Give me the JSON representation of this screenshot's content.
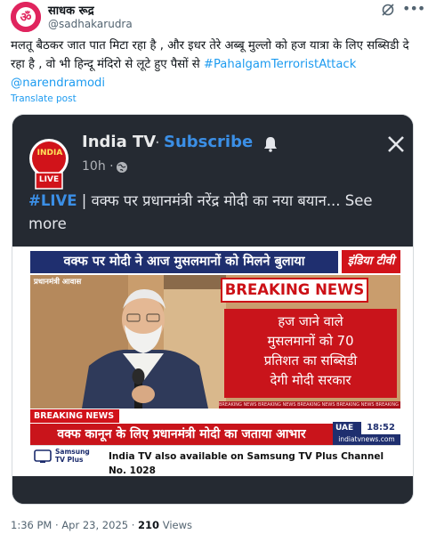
{
  "user": {
    "display_name": "साधक रूद्र",
    "handle": "@sadhakarudra",
    "avatar_color": "#e0245e"
  },
  "post": {
    "text_plain": "मलतू बैठकर जात पात मिटा रहा है , और इधर तेरे अब्बू मुल्लो को हज यात्रा के लिए सब्सिडी दे रहा है , वो भी हिन्दू मंदिरो से लूटे हुए पैसों से ",
    "hashtag": "#PahalgamTerroristAttack",
    "mention": "@narendramodi",
    "translate_label": "Translate post",
    "time": "1:36 PM",
    "date": "Apr 23, 2025",
    "views_count": "210",
    "views_label": "Views"
  },
  "media": {
    "channel_name": "India TV",
    "separator": "·",
    "subscribe_label": "Subscribe",
    "post_age": "10h ·",
    "live_tag": "#LIVE",
    "caption_text": " | वक्फ पर प्रधानमंत्री नरेंद्र मोदी का नया बयान...",
    "see_more": " See more",
    "logo_text": "INDIA",
    "logo_live": "LIVE",
    "top_banner": "वक्फ पर मोदी ने आज मुसलमानों को मिलने बुलाया",
    "india_tv_logo": "इंडिया टीवी",
    "photo_label": "प्रधानमंत्री आवास",
    "breaking_title": "BREAKING NEWS",
    "panel_lines": [
      "हज जाने वाले",
      "मुसलमानों को 70",
      "प्रतिशत का सब्सिडी",
      "देगी मोदी सरकार"
    ],
    "ticker": "BREAKING NEWS BREAKING NEWS BREAKING NEWS BREAKING NEWS BREAKING",
    "breaking_badge": "BREAKING NEWS",
    "lower_band": "वक्फ कानून के लिए प्रधानमंत्री मोदी का जताया आभार",
    "uae_label": "UAE",
    "uae_time": "18:52",
    "site": "indiatvnews.com",
    "samsung_line1": "Samsung",
    "samsung_line2": "TV Plus",
    "promo_text": "India TV also available on Samsung TV Plus Channel No. 1028"
  },
  "colors": {
    "link": "#1d9bf0",
    "fb_bg": "#252a32",
    "news_navy": "#1f2f6f",
    "news_red": "#c9141b"
  },
  "icons": [
    "grok-icon",
    "more-icon",
    "bell-icon",
    "close-icon",
    "globe-icon",
    "samsung-tv-icon"
  ]
}
